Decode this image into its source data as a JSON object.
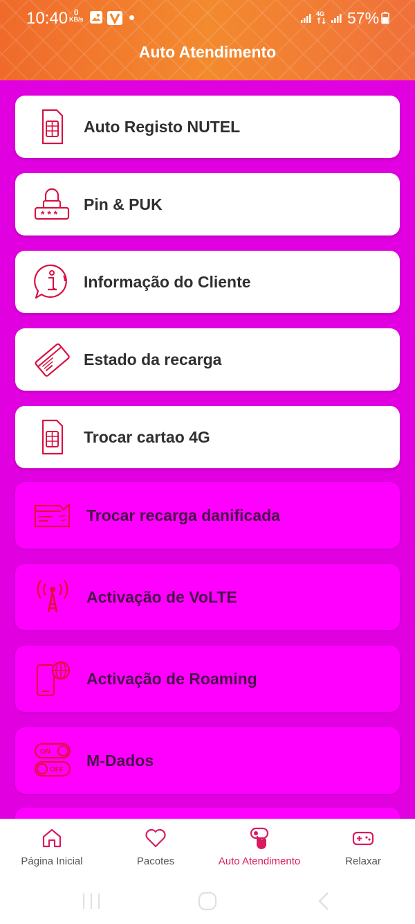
{
  "status_bar": {
    "time": "10:40",
    "net_speed_value": "0",
    "net_speed_unit": "KB/s",
    "battery": "57%"
  },
  "header": {
    "title": "Auto Atendimento"
  },
  "menu": {
    "items": [
      {
        "label": "Auto Registo NUTEL",
        "icon": "sim-card-icon"
      },
      {
        "label": "Pin & PUK",
        "icon": "lock-pin-icon"
      },
      {
        "label": "Informação do Cliente",
        "icon": "info-bubble-icon"
      },
      {
        "label": "Estado da recarga",
        "icon": "card-icon"
      },
      {
        "label": "Trocar cartao 4G",
        "icon": "sim-card-icon"
      },
      {
        "label": "Trocar recarga danificada",
        "icon": "damaged-card-icon"
      },
      {
        "label": "Activação de VoLTE",
        "icon": "antenna-icon"
      },
      {
        "label": "Activação de Roaming",
        "icon": "phone-globe-icon"
      },
      {
        "label": "M-Dados",
        "icon": "toggle-on-off-icon",
        "toggle_on": "ON",
        "toggle_off": "OFF"
      }
    ]
  },
  "bottom_nav": {
    "items": [
      {
        "label": "Página Inicial",
        "icon": "home-icon",
        "active": false
      },
      {
        "label": "Pacotes",
        "icon": "heart-icon",
        "active": false
      },
      {
        "label": "Auto Atendimento",
        "icon": "self-service-icon",
        "active": true
      },
      {
        "label": "Relaxar",
        "icon": "gamepad-icon",
        "active": false
      }
    ]
  },
  "colors": {
    "header_orange": "#f38a2e",
    "background_magenta": "#e000e0",
    "pink_card": "#ff00ff",
    "icon_red": "#e0103a",
    "active_nav": "#d81b60"
  }
}
